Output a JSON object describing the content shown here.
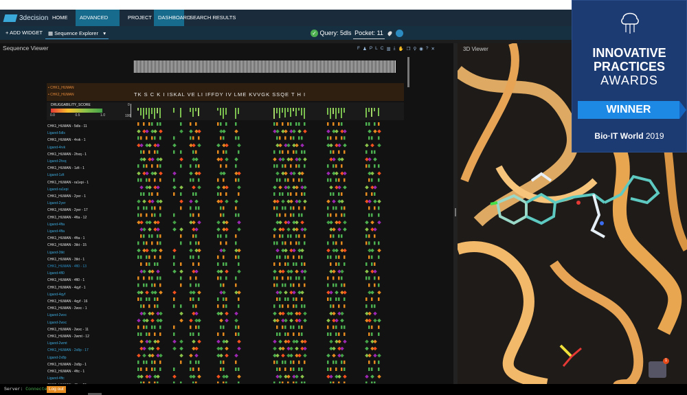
{
  "nav": {
    "brand": "3decision",
    "items": [
      {
        "label": "HOME",
        "active": false
      },
      {
        "label": "ADVANCED SEARCH",
        "active": true
      },
      {
        "label": "PROJECT",
        "active": false
      },
      {
        "label": "DASHBOARD",
        "active": true
      },
      {
        "label": "SEARCH RESULTS",
        "active": false
      }
    ]
  },
  "toolbar": {
    "add_widget": "ADD WIDGET",
    "widget_select": "Sequence Explorer",
    "query": "Query: 5dls",
    "pocket": "Pocket: 11"
  },
  "sequence_viewer": {
    "title": "Sequence Viewer",
    "tools": [
      "F",
      "P",
      "L",
      "C"
    ],
    "legend_names": [
      "CHK1_HUMAN",
      "CHK2_HUMAN"
    ],
    "motif": "TK S C K I ISKAL VE LI IFFDY IV LME KVVGK SSQE T H I",
    "druggability": {
      "label": "DRUGGABILITY_SCORE",
      "ticks": [
        "0.0",
        "0.5",
        "1.0"
      ],
      "axis_min": "0",
      "axis_max": "100"
    },
    "rows": [
      {
        "label": "CHK1_HUMAN - 5dls - 11",
        "style": "w"
      },
      {
        "label": "Ligand-5dls",
        "style": "b"
      },
      {
        "label": "CHK1_HUMAN - 4rvk - 1",
        "style": "w"
      },
      {
        "label": "Ligand-4rvk",
        "style": "b"
      },
      {
        "label": "CHK1_HUMAN - 2hxq - 1",
        "style": "w"
      },
      {
        "label": "Ligand-2hxq",
        "style": "b"
      },
      {
        "label": "CHK1_HUMAN - 1zlt - 1",
        "style": "w"
      },
      {
        "label": "Ligand-1zlt",
        "style": "b"
      },
      {
        "label": "CHK1_HUMAN - ra1epi - 1",
        "style": "w"
      },
      {
        "label": "Ligand-ra1epi",
        "style": "b"
      },
      {
        "label": "CHK1_HUMAN - 2yer - 1",
        "style": "w"
      },
      {
        "label": "Ligand-2yer",
        "style": "b"
      },
      {
        "label": "CHK1_HUMAN - 2yer - 17",
        "style": "w"
      },
      {
        "label": "CHK1_HUMAN - 4fta - 12",
        "style": "w"
      },
      {
        "label": "Ligand-4fta",
        "style": "b"
      },
      {
        "label": "Ligand-4fta",
        "style": "b"
      },
      {
        "label": "CHK1_HUMAN - 4fta - 1",
        "style": "w"
      },
      {
        "label": "CHK1_HUMAN - 3tkt - 15",
        "style": "w"
      },
      {
        "label": "Ligand-3tkt",
        "style": "b"
      },
      {
        "label": "CHK1_HUMAN - 3tkt - 1",
        "style": "w"
      },
      {
        "label": "CHK1_HUMAN - 4fl0 - 13",
        "style": "hl"
      },
      {
        "label": "Ligand-4fl0",
        "style": "b"
      },
      {
        "label": "CHK1_HUMAN - 4fl0 - 1",
        "style": "w"
      },
      {
        "label": "CHK1_HUMAN - 4qyf - 1",
        "style": "w"
      },
      {
        "label": "Ligand-4qyf",
        "style": "b"
      },
      {
        "label": "CHK1_HUMAN - 4qyf - 16",
        "style": "w"
      },
      {
        "label": "CHK1_HUMAN - 2wxc - 1",
        "style": "w"
      },
      {
        "label": "Ligand-2wxc",
        "style": "b"
      },
      {
        "label": "Ligand-2wxc",
        "style": "b"
      },
      {
        "label": "CHK1_HUMAN - 2wxc - 11",
        "style": "w"
      },
      {
        "label": "CHK1_HUMAN - 2wmt - 12",
        "style": "w"
      },
      {
        "label": "Ligand-2wmt",
        "style": "b"
      },
      {
        "label": "CHK1_HUMAN - 2x8p - 17",
        "style": "b"
      },
      {
        "label": "Ligand-2x8p",
        "style": "b"
      },
      {
        "label": "CHK1_HUMAN - 2x8p - 1",
        "style": "w"
      },
      {
        "label": "CHK1_HUMAN - 4ftc - 1",
        "style": "w"
      },
      {
        "label": "Ligand-4ftc",
        "style": "b"
      },
      {
        "label": "CHK1_HUMAN - 4ftc - 15",
        "style": "w"
      }
    ]
  },
  "viewer_3d": {
    "title": "3D Viewer",
    "notification_count": "1"
  },
  "status": {
    "server_label": "Server:",
    "server_state": "Connected",
    "logout": "Log out"
  },
  "award": {
    "line1": "INNOVATIVE",
    "line2": "PRACTICES",
    "line3": "AWARDS",
    "ribbon": "WINNER",
    "event": "Bio·IT World",
    "year": "2019"
  }
}
